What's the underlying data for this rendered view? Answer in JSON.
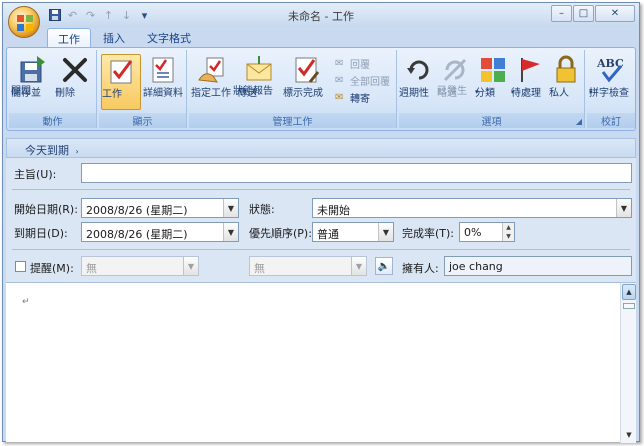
{
  "window": {
    "title": "未命名 - 工作"
  },
  "quick_access": {
    "icons": [
      "save-icon",
      "undo-icon",
      "redo-icon",
      "up-icon",
      "down-icon",
      "customize-icon"
    ]
  },
  "tabs": [
    {
      "label": "工作",
      "active": true
    },
    {
      "label": "插入",
      "active": false
    },
    {
      "label": "文字格式",
      "active": false
    }
  ],
  "ribbon": {
    "groups": {
      "actions": {
        "label": "動作",
        "save_close": [
          "儲存並",
          "關閉"
        ],
        "delete": "刪除"
      },
      "show": {
        "label": "顯示",
        "task": "工作",
        "details": "詳細資料"
      },
      "manage": {
        "label": "管理工作",
        "assign": "指定工作",
        "send_status": [
          "傳送",
          "狀態報告"
        ],
        "mark_complete": "標示完成",
        "reply": "回覆",
        "reply_all": "全部回覆",
        "forward": "轉寄"
      },
      "options": {
        "label": "選項",
        "recurrence": "週期性",
        "skip": [
          "略過",
          "已發生"
        ],
        "categorize": "分類",
        "follow_up": "待處理",
        "private": "私人"
      },
      "proofing": {
        "label": "校訂",
        "spelling": "拼字檢查"
      }
    }
  },
  "due_banner": "今天到期",
  "form": {
    "subject": {
      "label": "主旨(U):",
      "value": ""
    },
    "start_date": {
      "label": "開始日期(R):",
      "value": "2008/8/26 (星期二)"
    },
    "due_date": {
      "label": "到期日(D):",
      "value": "2008/8/26 (星期二)"
    },
    "status": {
      "label": "狀態:",
      "value": "未開始"
    },
    "priority": {
      "label": "優先順序(P):",
      "value": "普通"
    },
    "percent": {
      "label": "完成率(T):",
      "value": "0%"
    },
    "reminder": {
      "label": "提醒(M):",
      "date": "無",
      "time": "無",
      "checked": false
    },
    "owner": {
      "label": "擁有人:",
      "value": "joe chang"
    }
  },
  "body": {
    "paragraph_mark": "↵"
  },
  "colors": {
    "ribbon_bg": "#d9e7f8",
    "accent": "#15428b",
    "selected": "#f8c960"
  }
}
